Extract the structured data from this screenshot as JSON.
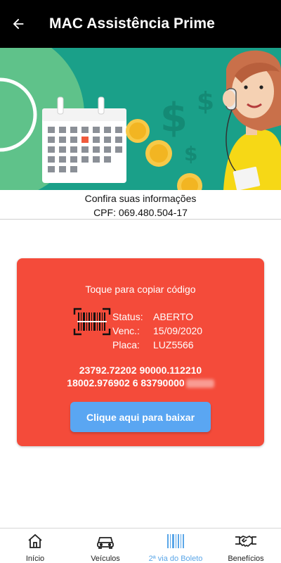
{
  "header": {
    "title": "MAC Assistência Prime",
    "back_icon": "arrow-left-icon"
  },
  "info": {
    "line1": "Confira suas informações",
    "cpf": "CPF: 069.480.504-17"
  },
  "boleto": {
    "copy_hint": "Toque para copiar código",
    "status_label": "Status:",
    "status_value": "ABERTO",
    "venc_label": "Venc.:",
    "venc_value": "15/09/2020",
    "placa_label": "Placa:",
    "placa_value": "LUZ5566",
    "code_line1": "23792.72202 90000.112210",
    "code_line2": "18002.976902 6 83790000",
    "download_label": "Clique aqui para baixar",
    "card_color": "#f44b3a",
    "button_color": "#5aa6f2"
  },
  "nav": {
    "items": [
      {
        "label": "Início",
        "icon": "home-icon"
      },
      {
        "label": "Veículos",
        "icon": "car-icon"
      },
      {
        "label": "2ª via do Boleto",
        "icon": "barcode-icon"
      },
      {
        "label": "Benefícios",
        "icon": "handshake-icon"
      }
    ],
    "active_index": 2,
    "active_color": "#5aa6e8"
  }
}
